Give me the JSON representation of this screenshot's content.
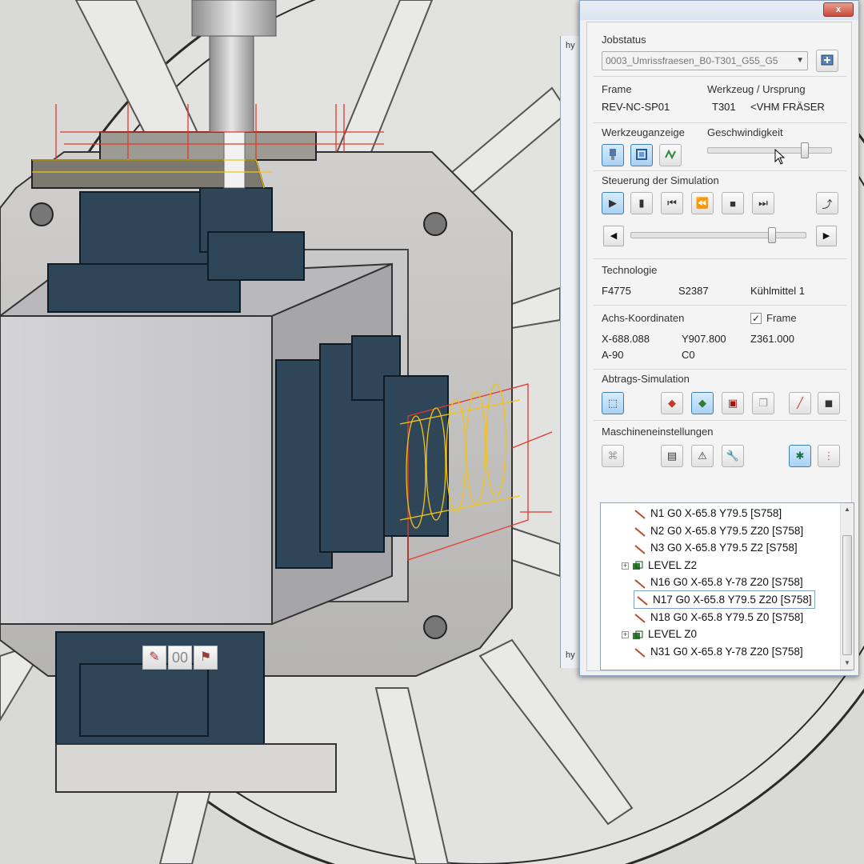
{
  "panel": {
    "close_label": "x",
    "jobstatus": {
      "label": "Jobstatus",
      "selected_job": "0003_Umrissfraesen_B0-T301_G55_G5"
    },
    "frame": {
      "label": "Frame",
      "value": "REV-NC-SP01"
    },
    "tool": {
      "label": "Werkzeug / Ursprung",
      "number": "T301",
      "name": "<VHM FRÄSER"
    },
    "tool_display": {
      "label": "Werkzeuganzeige"
    },
    "speed": {
      "label": "Geschwindigkeit",
      "level": 0.8
    },
    "simulation_control": {
      "label": "Steuerung der Simulation",
      "progress": 0.82
    },
    "technology": {
      "label": "Technologie",
      "feed": "F4775",
      "spindle": "S2387",
      "coolant": "Kühlmittel 1"
    },
    "axis_coordinates": {
      "label": "Achs-Koordinaten",
      "frame_checkbox_label": "Frame",
      "frame_checked": true,
      "x": "X-688.088",
      "y": "Y907.800",
      "z": "Z361.000",
      "a": "A-90",
      "c": "C0"
    },
    "removal_simulation": {
      "label": "Abtrags-Simulation"
    },
    "machine_settings": {
      "label": "Maschineneinstellungen"
    },
    "nc_tree": [
      {
        "kind": "line",
        "text": "N1 G0 X-65.8 Y79.5  [S758]"
      },
      {
        "kind": "line",
        "text": "N2 G0 X-65.8 Y79.5 Z20  [S758]"
      },
      {
        "kind": "line",
        "text": "N3 G0 X-65.8 Y79.5 Z2  [S758]"
      },
      {
        "kind": "level",
        "text": "LEVEL Z2"
      },
      {
        "kind": "line",
        "text": "N16 G0 X-65.8 Y-78 Z20  [S758]"
      },
      {
        "kind": "line",
        "text": "N17 G0 X-65.8 Y79.5 Z20  [S758]",
        "selected": true
      },
      {
        "kind": "line",
        "text": "N18 G0 X-65.8 Y79.5 Z0  [S758]"
      },
      {
        "kind": "level",
        "text": "LEVEL Z0"
      },
      {
        "kind": "line",
        "text": "N31 G0 X-65.8 Y-78 Z20  [S758]"
      }
    ]
  },
  "background_window": {
    "fragment_top": "hy",
    "fragment_bottom": "hy"
  },
  "viewport_toolbar": {
    "counter": "00"
  }
}
